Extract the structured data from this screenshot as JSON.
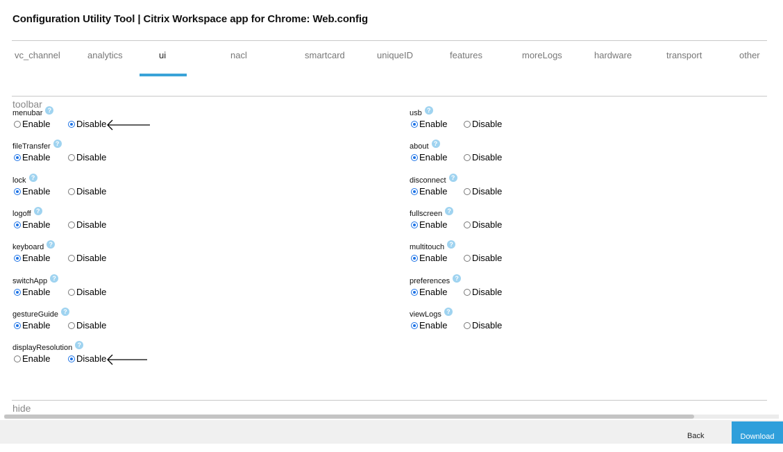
{
  "title": "Configuration Utility Tool | Citrix Workspace app for Chrome: Web.config",
  "tabs": [
    {
      "label": "vc_channel"
    },
    {
      "label": "analytics"
    },
    {
      "label": "ui"
    },
    {
      "label": "nacl"
    },
    {
      "label": "smartcard"
    },
    {
      "label": "uniqueID"
    },
    {
      "label": "features"
    },
    {
      "label": "moreLogs"
    },
    {
      "label": "hardware"
    },
    {
      "label": "transport"
    },
    {
      "label": "other"
    }
  ],
  "active_tab": "ui",
  "sections": {
    "toolbar": "toolbar",
    "hide": "hide"
  },
  "radio_labels": {
    "enable": "Enable",
    "disable": "Disable"
  },
  "help_glyph": "?",
  "left_options": [
    {
      "name": "menubar",
      "value": "Disable"
    },
    {
      "name": "fileTransfer",
      "value": "Enable"
    },
    {
      "name": "lock",
      "value": "Enable"
    },
    {
      "name": "logoff",
      "value": "Enable"
    },
    {
      "name": "keyboard",
      "value": "Enable"
    },
    {
      "name": "switchApp",
      "value": "Enable"
    },
    {
      "name": "gestureGuide",
      "value": "Enable"
    },
    {
      "name": "displayResolution",
      "value": "Disable"
    }
  ],
  "right_options": [
    {
      "name": "usb",
      "value": "Enable"
    },
    {
      "name": "about",
      "value": "Enable"
    },
    {
      "name": "disconnect",
      "value": "Enable"
    },
    {
      "name": "fullscreen",
      "value": "Enable"
    },
    {
      "name": "multitouch",
      "value": "Enable"
    },
    {
      "name": "preferences",
      "value": "Enable"
    },
    {
      "name": "viewLogs",
      "value": "Enable"
    }
  ],
  "footer": {
    "back_label": "Back",
    "download_label": "Download"
  },
  "colors": {
    "accent": "#3aa3d8",
    "radio_selected": "#1d73e6",
    "help": "#9fd3f0"
  }
}
